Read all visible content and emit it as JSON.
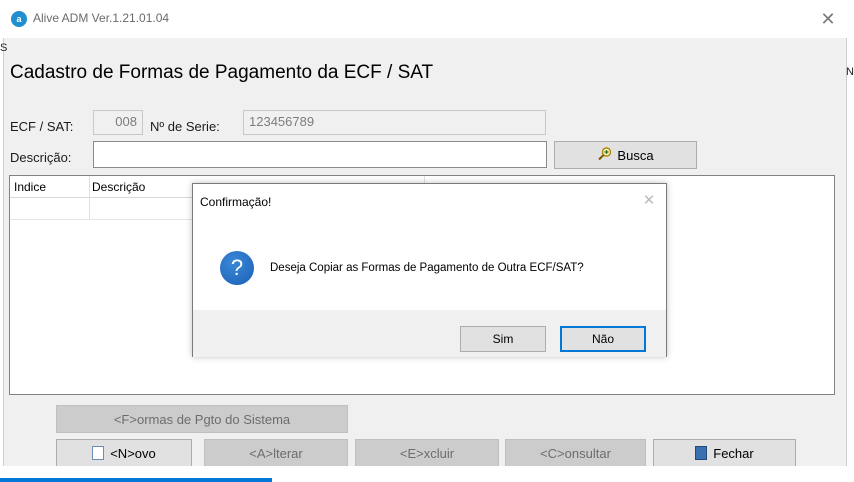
{
  "window": {
    "title": "Alive ADM Ver.1.21.01.04",
    "close_glyph": "✕",
    "app_icon": "a",
    "edge_left_char": "S",
    "edge_right_char": "N"
  },
  "form": {
    "title": "Cadastro de Formas de Pagamento da ECF / SAT",
    "ecf_label": "ECF / SAT:",
    "ecf_value": "008",
    "serie_label": "Nº de Serie:",
    "serie_value": "123456789",
    "descricao_label": "Descrição:",
    "descricao_value": "",
    "busca_label": "Busca",
    "busca_icon": "magnifier-plus-icon"
  },
  "grid": {
    "columns": [
      "Indice",
      "Descrição"
    ],
    "rows": []
  },
  "dialog": {
    "title": "Confirmação!",
    "close_glyph": "✕",
    "icon_glyph": "?",
    "message": "Deseja Copiar as Formas de Pagamento de Outra ECF/SAT?",
    "yes_label": "Sim",
    "no_label": "Não"
  },
  "buttons": {
    "formas_sistema": "<F>ormas de Pgto do Sistema",
    "novo": "<N>ovo",
    "alterar": "<A>lterar",
    "excluir": "<E>xcluir",
    "consultar": "<C>onsultar",
    "fechar": "Fechar"
  },
  "colors": {
    "accent": "#0078d7",
    "window_bg": "#f0f0f0",
    "disabled_btn": "#cccccc"
  }
}
